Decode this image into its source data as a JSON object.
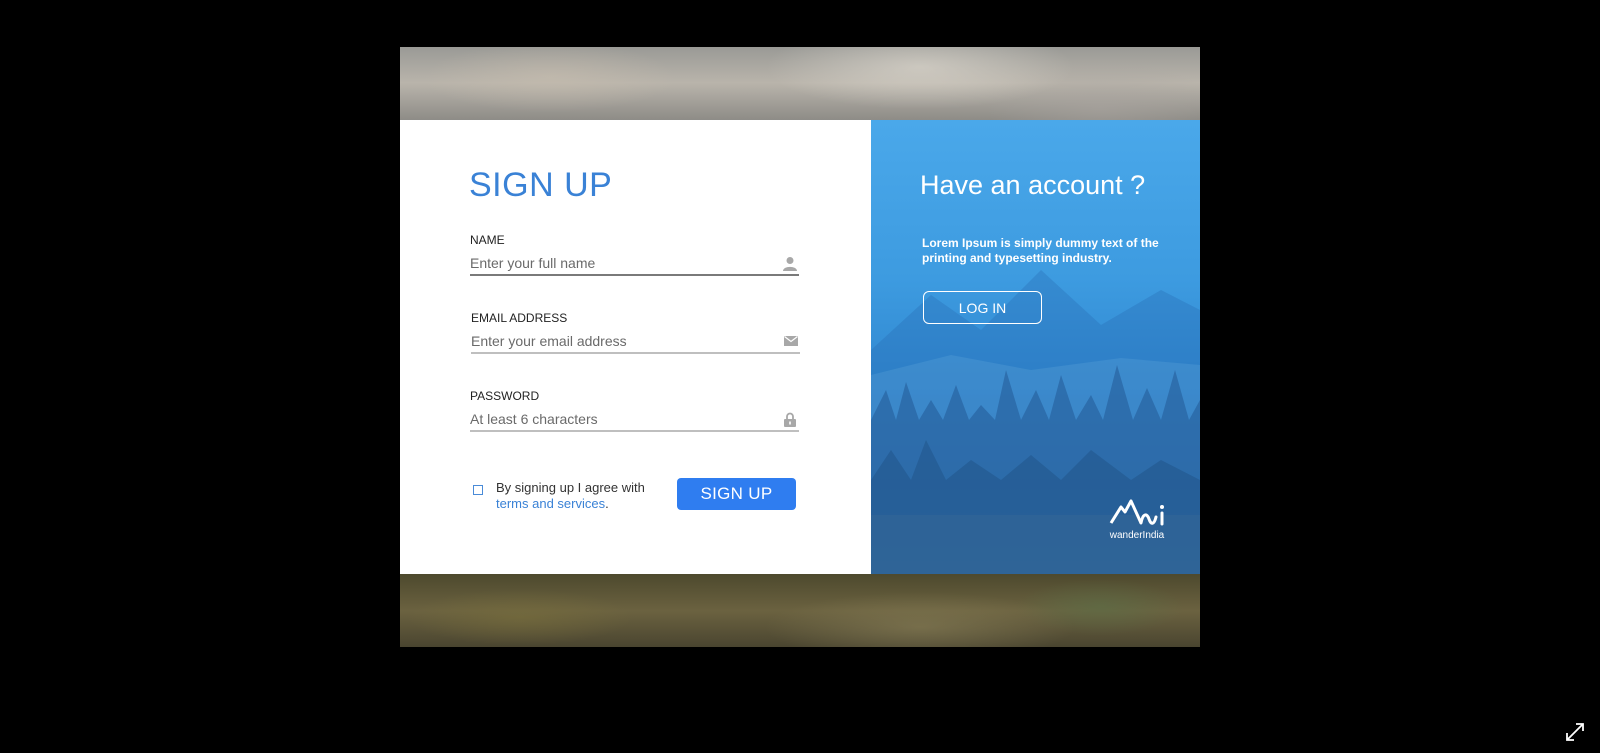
{
  "signup": {
    "title": "SIGN UP",
    "name_label": "NAME",
    "name_placeholder": "Enter your full name",
    "email_label": "EMAIL ADDRESS",
    "email_placeholder": "Enter your email address",
    "password_label": "PASSWORD",
    "password_placeholder": "At least 6 characters",
    "agree_text": "By signing up I agree with",
    "terms_link": "terms and services",
    "terms_suffix": ".",
    "button_label": "SIGN UP"
  },
  "login_panel": {
    "title": "Have an account ?",
    "description": "Lorem Ipsum is simply dummy text of the printing and typesetting industry.",
    "button_label": "LOG IN",
    "brand": "wanderIndia"
  },
  "icons": {
    "name_field": "user-icon",
    "email_field": "envelope-icon",
    "password_field": "lock-icon",
    "expand": "expand-icon"
  },
  "colors": {
    "accent": "#3a82d6",
    "button": "#2f7df0",
    "panel": "#3d9be0"
  }
}
